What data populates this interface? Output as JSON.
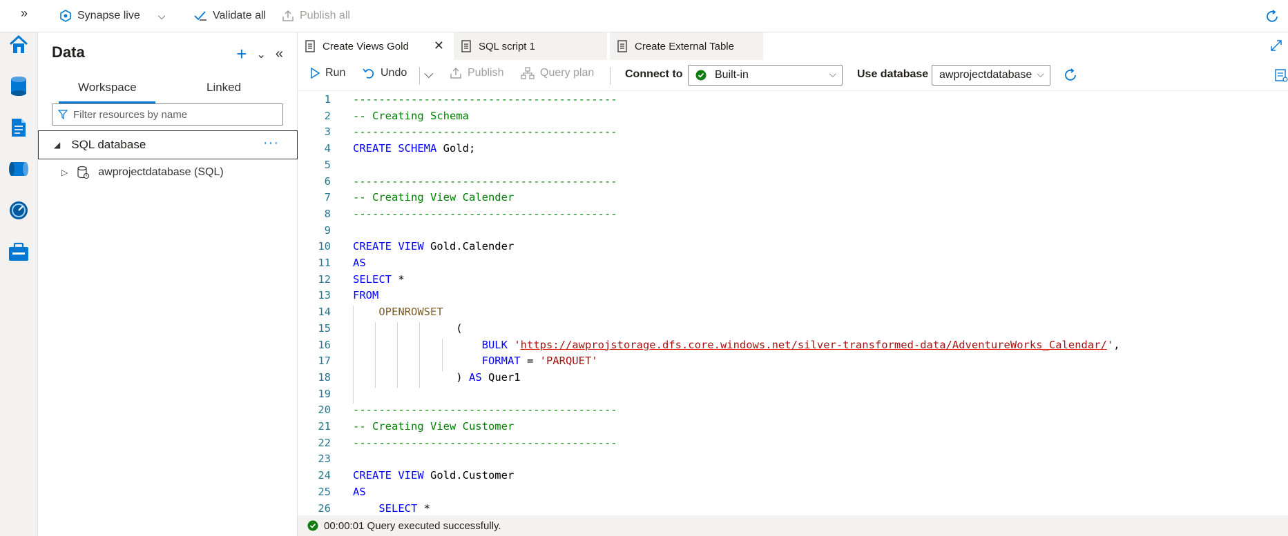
{
  "topbar": {
    "workspace_label": "Synapse live",
    "validate_label": "Validate all",
    "publish_label": "Publish all"
  },
  "panel": {
    "title": "Data",
    "tabs": [
      {
        "label": "Workspace",
        "active": true
      },
      {
        "label": "Linked",
        "active": false
      }
    ],
    "filter_placeholder": "Filter resources by name",
    "section_label": "SQL database",
    "tree_item": "awprojectdatabase (SQL)"
  },
  "doc_tabs": [
    {
      "label": "Create Views Gold",
      "active": true
    },
    {
      "label": "SQL script 1",
      "active": false
    },
    {
      "label": "Create External Table",
      "active": false
    }
  ],
  "toolbar": {
    "run_label": "Run",
    "undo_label": "Undo",
    "publish_label": "Publish",
    "query_plan_label": "Query plan",
    "connect_to_label": "Connect to",
    "connect_value": "Built-in",
    "use_database_label": "Use database",
    "database_value": "awprojectdatabase"
  },
  "code_lines": [
    {
      "n": "1",
      "parts": [
        {
          "c": "cm",
          "t": "-----------------------------------------"
        }
      ]
    },
    {
      "n": "2",
      "parts": [
        {
          "c": "cm",
          "t": "-- Creating Schema"
        }
      ]
    },
    {
      "n": "3",
      "parts": [
        {
          "c": "cm",
          "t": "-----------------------------------------"
        }
      ]
    },
    {
      "n": "4",
      "parts": [
        {
          "c": "kw",
          "t": "CREATE SCHEMA "
        },
        {
          "c": "",
          "t": "Gold;"
        }
      ]
    },
    {
      "n": "5",
      "parts": []
    },
    {
      "n": "6",
      "parts": [
        {
          "c": "cm",
          "t": "-----------------------------------------"
        }
      ]
    },
    {
      "n": "7",
      "parts": [
        {
          "c": "cm",
          "t": "-- Creating View Calender"
        }
      ]
    },
    {
      "n": "8",
      "parts": [
        {
          "c": "cm",
          "t": "-----------------------------------------"
        }
      ]
    },
    {
      "n": "9",
      "parts": []
    },
    {
      "n": "10",
      "parts": [
        {
          "c": "kw",
          "t": "CREATE VIEW "
        },
        {
          "c": "",
          "t": "Gold.Calender"
        }
      ]
    },
    {
      "n": "11",
      "parts": [
        {
          "c": "kw",
          "t": "AS"
        }
      ]
    },
    {
      "n": "12",
      "parts": [
        {
          "c": "kw",
          "t": "SELECT "
        },
        {
          "c": "",
          "t": "*"
        }
      ]
    },
    {
      "n": "13",
      "parts": [
        {
          "c": "kw",
          "t": "FROM"
        }
      ]
    },
    {
      "n": "14",
      "parts": [
        {
          "c": "",
          "t": "    "
        },
        {
          "c": "fn",
          "t": "OPENROWSET"
        }
      ]
    },
    {
      "n": "15",
      "parts": [
        {
          "c": "",
          "t": "                ("
        }
      ]
    },
    {
      "n": "16",
      "parts": [
        {
          "c": "",
          "t": "                    "
        },
        {
          "c": "kw",
          "t": "BULK "
        },
        {
          "c": "str",
          "t": "'"
        },
        {
          "c": "url",
          "t": "https://awprojstorage.dfs.core.windows.net/silver-transformed-data/AdventureWorks_Calendar/"
        },
        {
          "c": "str",
          "t": "'"
        },
        {
          "c": "",
          "t": ","
        }
      ]
    },
    {
      "n": "17",
      "parts": [
        {
          "c": "",
          "t": "                    "
        },
        {
          "c": "kw",
          "t": "FORMAT "
        },
        {
          "c": "",
          "t": "= "
        },
        {
          "c": "str",
          "t": "'PARQUET'"
        }
      ]
    },
    {
      "n": "18",
      "parts": [
        {
          "c": "",
          "t": "                ) "
        },
        {
          "c": "kw",
          "t": "AS "
        },
        {
          "c": "",
          "t": "Quer1"
        }
      ]
    },
    {
      "n": "19",
      "parts": []
    },
    {
      "n": "20",
      "parts": [
        {
          "c": "cm",
          "t": "-----------------------------------------"
        }
      ]
    },
    {
      "n": "21",
      "parts": [
        {
          "c": "cm",
          "t": "-- Creating View Customer"
        }
      ]
    },
    {
      "n": "22",
      "parts": [
        {
          "c": "cm",
          "t": "-----------------------------------------"
        }
      ]
    },
    {
      "n": "23",
      "parts": []
    },
    {
      "n": "24",
      "parts": [
        {
          "c": "kw",
          "t": "CREATE VIEW "
        },
        {
          "c": "",
          "t": "Gold.Customer"
        }
      ]
    },
    {
      "n": "25",
      "parts": [
        {
          "c": "kw",
          "t": "AS"
        }
      ]
    },
    {
      "n": "26",
      "parts": [
        {
          "c": "",
          "t": "    "
        },
        {
          "c": "kw",
          "t": "SELECT "
        },
        {
          "c": "",
          "t": "*"
        }
      ]
    }
  ],
  "status": {
    "message": "00:00:01 Query executed successfully."
  },
  "colors": {
    "accent": "#0078d4",
    "success": "#107c10",
    "comment": "#008000",
    "keyword": "#0000ff",
    "string": "#a31515"
  }
}
